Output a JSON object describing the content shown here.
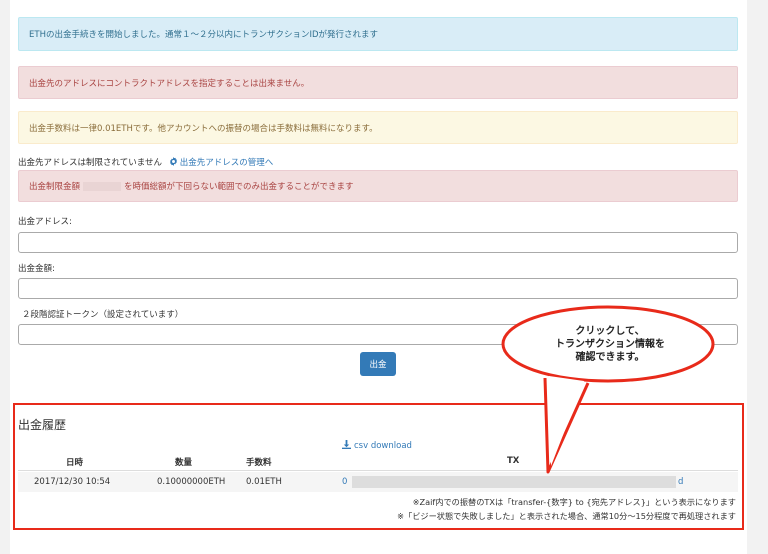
{
  "alerts": {
    "info": "ETHの出金手続きを開始しました。通常１～２分以内にトランザクションIDが発行されます",
    "danger_contract": "出金先のアドレスにコントラクトアドレスを指定することは出来ません。",
    "warning_fee": "出金手数料は一律0.01ETHです。他アカウントへの振替の場合は手数料は無料になります。",
    "limit_prefix": "出金制限金額",
    "limit_suffix": "を時価総額が下回らない範囲でのみ出金することができます"
  },
  "restriction": {
    "text": "出金先アドレスは制限されていません",
    "manage_link": "出金先アドレスの管理へ"
  },
  "form": {
    "address_label": "出金アドレス:",
    "amount_label": "出金金額:",
    "token_label": "２段階認証トークン（設定されています）",
    "submit_label": "出金"
  },
  "callout": {
    "line1": "クリックして、",
    "line2": "トランザクション情報を",
    "line3": "確認できます。"
  },
  "history": {
    "title": "出金履歴",
    "csv_label": "csv download",
    "columns": [
      "日時",
      "数量",
      "手数料",
      "TX"
    ],
    "rows": [
      {
        "datetime": "2017/12/30 10:54",
        "amount": "0.10000000ETH",
        "fee": "0.01ETH",
        "tx_start": "0",
        "tx_end": "d"
      }
    ],
    "notes": [
      "※Zaif内での振替のTXは「transfer-{数字} to {宛先アドレス}」という表示になります",
      "※「ビジー状態で失敗しました」と表示された場合、通常10分～15分程度で再処理されます"
    ]
  },
  "colors": {
    "accent": "#337ab7",
    "highlight_red": "#e82a1a"
  }
}
